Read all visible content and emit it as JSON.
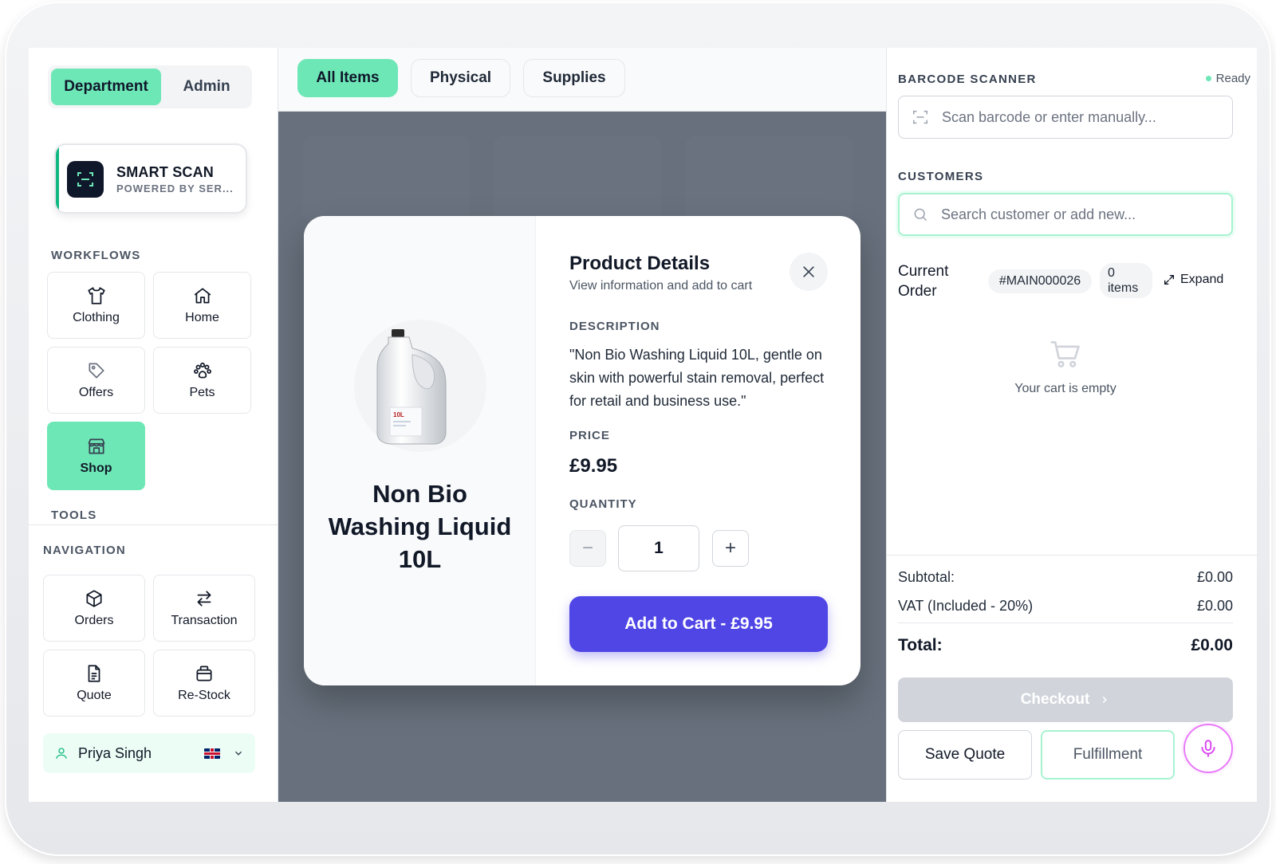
{
  "sidebar": {
    "segments": [
      "Department",
      "Admin"
    ],
    "smart_scan": {
      "title": "SMART SCAN",
      "subtitle": "POWERED BY SER..."
    },
    "workflows_label": "WORKFLOWS",
    "workflows": [
      {
        "label": "Clothing",
        "icon": "shirt-icon"
      },
      {
        "label": "Home",
        "icon": "home-icon"
      },
      {
        "label": "Offers",
        "icon": "tag-icon"
      },
      {
        "label": "Pets",
        "icon": "paw-icon"
      },
      {
        "label": "Shop",
        "icon": "store-icon",
        "active": true
      }
    ],
    "tools_label": "TOOLS",
    "navigation_label": "NAVIGATION",
    "navigation": [
      {
        "label": "Orders",
        "icon": "box-icon"
      },
      {
        "label": "Transaction",
        "icon": "arrows-swap-icon"
      },
      {
        "label": "Quote",
        "icon": "document-icon"
      },
      {
        "label": "Re-Stock",
        "icon": "restock-icon"
      }
    ],
    "user": {
      "name": "Priya Singh",
      "flag": "uk-flag-icon"
    }
  },
  "tabs": [
    "All Items",
    "Physical",
    "Supplies"
  ],
  "modal": {
    "title": "Product Details",
    "subtitle": "View information and add to cart",
    "product_name": "Non Bio Washing Liquid 10L",
    "product_label": "10L",
    "description_label": "DESCRIPTION",
    "description": "\"Non Bio Washing Liquid 10L, gentle on skin with powerful stain removal, perfect for retail and business use.\"",
    "price_label": "PRICE",
    "price": "£9.95",
    "quantity_label": "QUANTITY",
    "quantity": "1",
    "minus": "−",
    "plus": "+",
    "add_button": "Add to Cart - £9.95"
  },
  "right": {
    "barcode_label": "BARCODE SCANNER",
    "status": "Ready",
    "barcode_placeholder": "Scan barcode or enter manually...",
    "customers_label": "CUSTOMERS",
    "customer_placeholder": "Search customer or add new...",
    "current_order_label": "Current\nOrder",
    "order_id": "#MAIN000026",
    "items_count": "0\nitems",
    "expand": "Expand",
    "empty_cart": "Your cart is empty",
    "subtotal_label": "Subtotal:",
    "subtotal": "£0.00",
    "vat_label": "VAT (Included - 20%)",
    "vat": "£0.00",
    "total_label": "Total:",
    "total": "£0.00",
    "checkout": "Checkout",
    "save_quote": "Save Quote",
    "fulfillment": "Fulfillment"
  },
  "colors": {
    "accent": "#6ee7b7",
    "primary": "#4f46e5",
    "mic": "#e879f9"
  }
}
